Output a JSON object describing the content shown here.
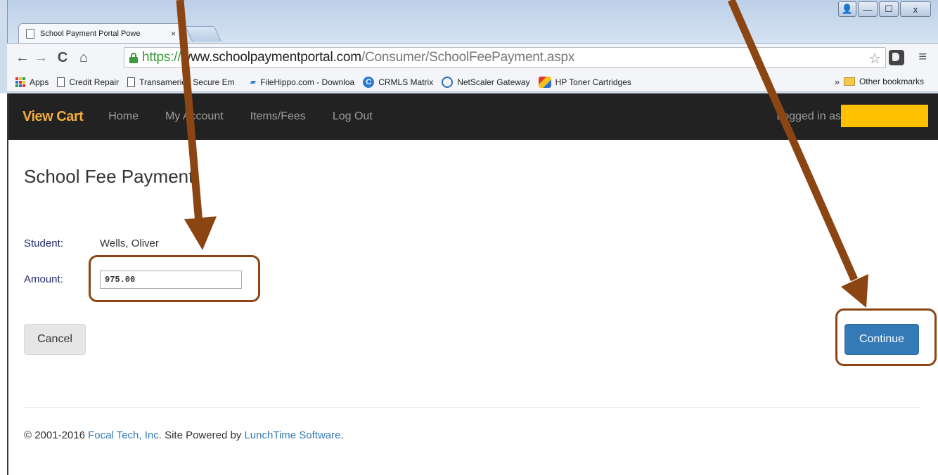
{
  "colors": {
    "navbar_bg": "#222222",
    "brand": "#f0ad3c",
    "nav_link": "#9d9d9d",
    "primary_button": "#337ab7",
    "annotation": "#8b4513",
    "redaction": "#ffc000"
  },
  "window": {
    "controls": [
      "user-icon",
      "minimize-icon",
      "maximize-icon",
      "close-icon"
    ],
    "control_glyphs": {
      "user": "👤",
      "min": "—",
      "max": "☐",
      "close": "x"
    }
  },
  "browser": {
    "tab": {
      "title": "School Payment Portal Powe",
      "close_glyph": "×"
    },
    "nav_glyphs": {
      "back": "←",
      "forward": "→",
      "reload": "C",
      "home": "⌂"
    },
    "url": {
      "scheme": "https://",
      "host": "www.schoolpaymentportal.com",
      "path": "/Consumer/SchoolFeePayment.aspx"
    },
    "star_glyph": "☆",
    "menu_glyph": "≡",
    "bookmarks": [
      {
        "label": "Apps",
        "icon": "apps-icon"
      },
      {
        "label": "Credit Repair",
        "icon": "page-icon"
      },
      {
        "label": "Transamerica Secure Em",
        "icon": "page-icon"
      },
      {
        "label": "FileHippo.com - Downloa",
        "icon": "filehippo-icon"
      },
      {
        "label": "CRMLS Matrix",
        "icon": "crmls-icon"
      },
      {
        "label": "NetScaler Gateway",
        "icon": "netscaler-icon"
      },
      {
        "label": "HP Toner Cartridges",
        "icon": "hp-icon"
      }
    ],
    "more_glyph": "»",
    "other_bookmarks": "Other bookmarks"
  },
  "navbar": {
    "brand": "View Cart",
    "links": [
      "Home",
      "My Account",
      "Items/Fees",
      "Log Out"
    ],
    "logged_in": "Logged in as"
  },
  "page": {
    "title": "School Fee Payment",
    "student_label": "Student:",
    "student_value": "Wells, Oliver",
    "amount_label": "Amount:",
    "amount_value": "975.00",
    "cancel_label": "Cancel",
    "continue_label": "Continue"
  },
  "footer": {
    "copyright": "© 2001-2016 ",
    "company": "Focal Tech, Inc.",
    "middle": " Site Powered by ",
    "software": "LunchTime Software",
    "end": "."
  }
}
